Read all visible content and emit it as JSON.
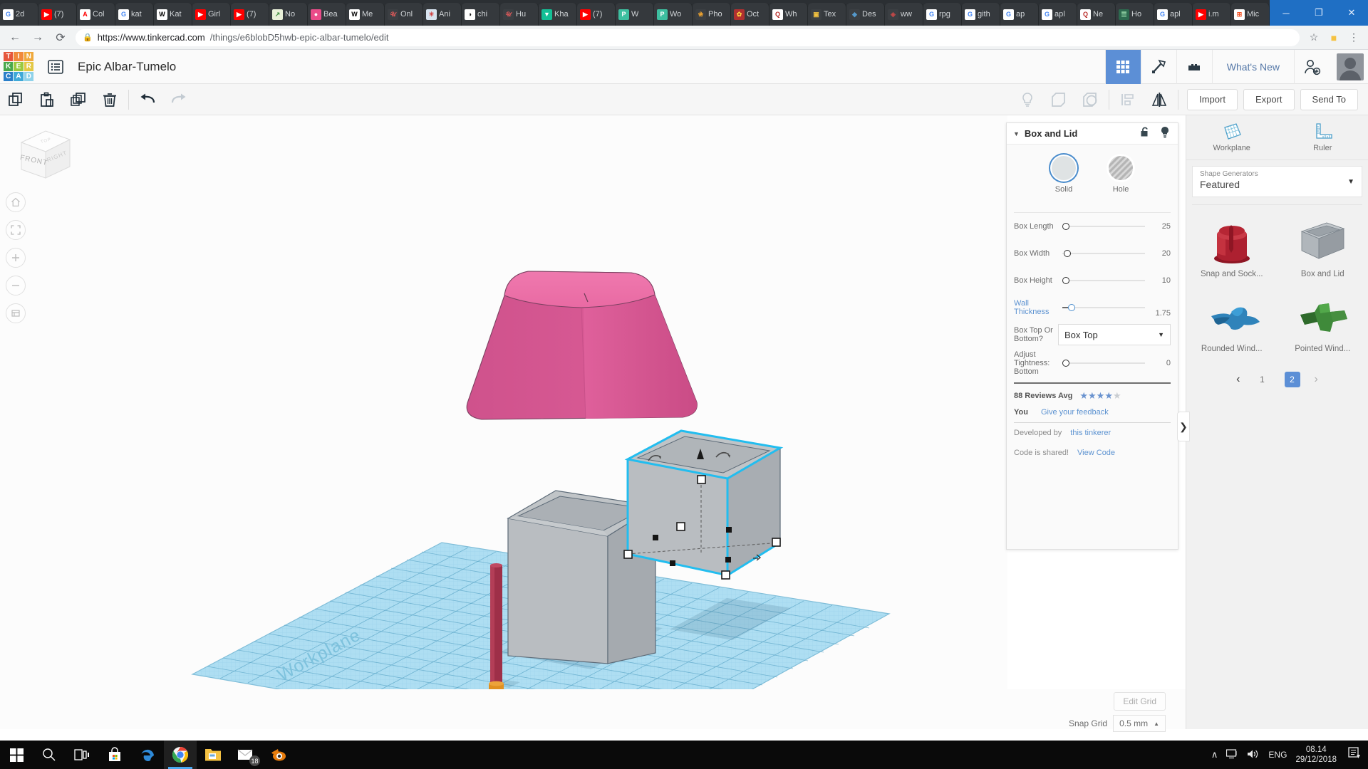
{
  "browser": {
    "tabs": [
      {
        "label": "2d",
        "favicon": "google-icon",
        "color": "#ffffff",
        "glyph": "G",
        "glyph_color": "#4285f4"
      },
      {
        "label": "(7)",
        "favicon": "youtube-icon",
        "color": "#ff0000",
        "glyph": "▶",
        "glyph_color": "#ffffff"
      },
      {
        "label": "Col",
        "favicon": "adobe-icon",
        "color": "#ffffff",
        "glyph": "A",
        "glyph_color": "#ff0000"
      },
      {
        "label": "kat",
        "favicon": "google-icon",
        "color": "#ffffff",
        "glyph": "G",
        "glyph_color": "#4285f4"
      },
      {
        "label": "Kat",
        "favicon": "wikipedia-icon",
        "color": "#ffffff",
        "glyph": "W",
        "glyph_color": "#000000"
      },
      {
        "label": "Girl",
        "favicon": "youtube-icon",
        "color": "#ff0000",
        "glyph": "▶",
        "glyph_color": "#ffffff"
      },
      {
        "label": "(7)",
        "favicon": "youtube-icon",
        "color": "#ff0000",
        "glyph": "▶",
        "glyph_color": "#ffffff"
      },
      {
        "label": "No",
        "favicon": "chart-icon",
        "color": "#e8f0d8",
        "glyph": "↗",
        "glyph_color": "#3c8c3c"
      },
      {
        "label": "Bea",
        "favicon": "dribbble-icon",
        "color": "#ea4c89",
        "glyph": "●",
        "glyph_color": "#ffffff"
      },
      {
        "label": "Me",
        "favicon": "wikipedia-icon",
        "color": "#ffffff",
        "glyph": "W",
        "glyph_color": "#000000"
      },
      {
        "label": "Onl",
        "favicon": "script-icon",
        "color": "#3b3f43",
        "glyph": "𝒰",
        "glyph_color": "#e05a5a"
      },
      {
        "label": "Ani",
        "favicon": "anime-icon",
        "color": "#d8e4f0",
        "glyph": "☀",
        "glyph_color": "#d04040"
      },
      {
        "label": "chi",
        "favicon": "pocket-icon",
        "color": "#ffffff",
        "glyph": "◑",
        "glyph_color": "#111111"
      },
      {
        "label": "Hu",
        "favicon": "script-icon",
        "color": "#3b3f43",
        "glyph": "𝒰",
        "glyph_color": "#e05a5a"
      },
      {
        "label": "Kha",
        "favicon": "khan-icon",
        "color": "#14bf96",
        "glyph": "▼",
        "glyph_color": "#ffffff"
      },
      {
        "label": "(7)",
        "favicon": "youtube-icon",
        "color": "#ff0000",
        "glyph": "▶",
        "glyph_color": "#ffffff"
      },
      {
        "label": "W",
        "favicon": "teal-icon",
        "color": "#3dbfa0",
        "glyph": "P",
        "glyph_color": "#ffffff"
      },
      {
        "label": "Wo",
        "favicon": "teal-icon",
        "color": "#3dbfa0",
        "glyph": "P",
        "glyph_color": "#ffffff"
      },
      {
        "label": "Pho",
        "favicon": "flower-icon",
        "color": "#3b3f43",
        "glyph": "❀",
        "glyph_color": "#e8a030"
      },
      {
        "label": "Oct",
        "favicon": "fire-icon",
        "color": "#b03030",
        "glyph": "✿",
        "glyph_color": "#ffd040"
      },
      {
        "label": "Wh",
        "favicon": "quora-icon",
        "color": "#ffffff",
        "glyph": "Q",
        "glyph_color": "#b92b27"
      },
      {
        "label": "Tex",
        "favicon": "blocks-icon",
        "color": "#3b3f43",
        "glyph": "▣",
        "glyph_color": "#f0c040"
      },
      {
        "label": "Des",
        "favicon": "blue-icon",
        "color": "#3b3f43",
        "glyph": "◆",
        "glyph_color": "#5599cc"
      },
      {
        "label": "ww",
        "favicon": "ruby-icon",
        "color": "#3b3f43",
        "glyph": "◈",
        "glyph_color": "#c04848"
      },
      {
        "label": "rpg",
        "favicon": "google-icon",
        "color": "#ffffff",
        "glyph": "G",
        "glyph_color": "#4285f4"
      },
      {
        "label": "gith",
        "favicon": "google-icon",
        "color": "#ffffff",
        "glyph": "G",
        "glyph_color": "#4285f4"
      },
      {
        "label": "ap",
        "favicon": "google-icon",
        "color": "#ffffff",
        "glyph": "G",
        "glyph_color": "#4285f4"
      },
      {
        "label": "apl",
        "favicon": "google-icon",
        "color": "#ffffff",
        "glyph": "G",
        "glyph_color": "#4285f4"
      },
      {
        "label": "Ne",
        "favicon": "quora-icon",
        "color": "#ffffff",
        "glyph": "Q",
        "glyph_color": "#b92b27"
      },
      {
        "label": "Ho",
        "favicon": "green-icon",
        "color": "#2d6a4f",
        "glyph": "☰",
        "glyph_color": "#9fe0b0"
      },
      {
        "label": "apl",
        "favicon": "google-icon",
        "color": "#ffffff",
        "glyph": "G",
        "glyph_color": "#4285f4"
      },
      {
        "label": "i.m",
        "favicon": "youtube-icon",
        "color": "#ff0000",
        "glyph": "▶",
        "glyph_color": "#ffffff"
      },
      {
        "label": "Mic",
        "favicon": "microsoft-icon",
        "color": "#ffffff",
        "glyph": "⊞",
        "glyph_color": "#f25022"
      }
    ],
    "active_tab": {
      "label": "",
      "favicon": "tinkercad-icon",
      "close": "×"
    },
    "newtab_label": "+",
    "window_controls": {
      "minimize": "─",
      "maximize": "❐",
      "close": "✕"
    },
    "nav": {
      "back": "←",
      "forward": "→",
      "reload": "⟳"
    },
    "url": {
      "lock": "🔒",
      "host": "https://www.tinkercad.com",
      "path": "/things/e6blobD5hwb-epic-albar-tumelo/edit"
    },
    "right_icons": [
      {
        "name": "star-icon",
        "glyph": "☆"
      },
      {
        "name": "extension-icon",
        "glyph": "■"
      },
      {
        "name": "menu-icon",
        "glyph": "⋮"
      }
    ]
  },
  "app_header": {
    "logo_tiles": [
      {
        "letter": "T",
        "color": "#e5563c"
      },
      {
        "letter": "I",
        "color": "#f08a3c"
      },
      {
        "letter": "N",
        "color": "#f0a93c"
      },
      {
        "letter": "K",
        "color": "#49a84c"
      },
      {
        "letter": "E",
        "color": "#9ac93f"
      },
      {
        "letter": "R",
        "color": "#e3c845"
      },
      {
        "letter": "C",
        "color": "#2a7fc9"
      },
      {
        "letter": "A",
        "color": "#3fa9d8"
      },
      {
        "letter": "D",
        "color": "#8fd2ea"
      }
    ],
    "hamburger_icon": "list-menu-icon",
    "doc_title": "Epic Albar-Tumelo",
    "buttons": [
      {
        "name": "grid-view-button",
        "glyph": "▦",
        "active": true
      },
      {
        "name": "pickaxe-button",
        "glyph": "⛏",
        "active": false
      },
      {
        "name": "blocks-button",
        "glyph": "▤",
        "active": false
      }
    ],
    "whats_new": "What's New",
    "invite_icon": "add-person-icon",
    "avatar": "user-avatar"
  },
  "toolbar": {
    "left_tools": [
      {
        "name": "copy-button",
        "glyph": "⧉"
      },
      {
        "name": "paste-button",
        "glyph": "📋"
      },
      {
        "name": "duplicate-button",
        "glyph": "❐"
      },
      {
        "name": "delete-button",
        "glyph": "🗑"
      },
      {
        "name": "undo-button",
        "glyph": "←"
      },
      {
        "name": "redo-button",
        "glyph": "→"
      }
    ],
    "right_tools": [
      {
        "name": "light-bulb-button",
        "glyph": "○"
      },
      {
        "name": "group-button",
        "glyph": "⬡"
      },
      {
        "name": "ungroup-button",
        "glyph": "◎"
      },
      {
        "name": "align-button",
        "glyph": "▥"
      },
      {
        "name": "mirror-button",
        "glyph": "◧"
      }
    ],
    "import_label": "Import",
    "export_label": "Export",
    "sendto_label": "Send To"
  },
  "viewport": {
    "viewcube": {
      "front": "FRONT",
      "right": "RIGHT",
      "top": "TOP"
    },
    "nav_buttons": [
      {
        "name": "home-view-button",
        "glyph": "⌂"
      },
      {
        "name": "fit-view-button",
        "glyph": "⬚"
      },
      {
        "name": "zoom-in-button",
        "glyph": "+"
      },
      {
        "name": "zoom-out-button",
        "glyph": "−"
      },
      {
        "name": "flat-view-button",
        "glyph": "⌸"
      }
    ],
    "workplane_label": "Workplane",
    "objects": [
      {
        "name": "pink-lid",
        "color": "#e0579a",
        "type": "tapered-box"
      },
      {
        "name": "grey-box-unselected",
        "color": "#b9bcbf",
        "type": "open-box"
      },
      {
        "name": "grey-box-selected",
        "color": "#b4b7ba",
        "type": "open-box",
        "selected": true,
        "highlight": "#22bdef"
      },
      {
        "name": "red-cylinder",
        "color": "#a03048",
        "type": "cylinder"
      },
      {
        "name": "orange-base",
        "color": "#e09020",
        "type": "cylinder"
      }
    ],
    "workplane_color": "#a8dcf0"
  },
  "properties_panel": {
    "title": "Box and Lid",
    "caret": "▼",
    "lock_icon": "unlock-icon",
    "bulb_icon": "light-bulb-icon",
    "solid_label": "Solid",
    "hole_label": "Hole",
    "sliders": [
      {
        "label": "Box Length",
        "value": "25",
        "knob_pct": 0,
        "fill_pct": 0,
        "link": false
      },
      {
        "label": "Box Width",
        "value": "20",
        "knob_pct": 0,
        "fill_pct": 0,
        "link": false
      },
      {
        "label": "Box Height",
        "value": "10",
        "knob_pct": 0,
        "fill_pct": 0,
        "link": false
      },
      {
        "label": "Wall Thickness",
        "value": "1.75",
        "knob_pct": 7,
        "fill_pct": 7,
        "link": true
      }
    ],
    "select_label": "Box Top Or Bottom?",
    "select_value": "Box Top",
    "select_caret": "▼",
    "tightness_label": "Adjust Tightness: Bottom",
    "tightness_value": "0",
    "reviews_text": "88 Reviews Avg",
    "stars_filled": 4,
    "stars_total": 5,
    "you_label": "You",
    "feedback_link": "Give your feedback",
    "developed_by_label": "Developed by",
    "developer_link": "this tinkerer",
    "code_shared_label": "Code is shared!",
    "view_code_link": "View Code"
  },
  "right_sidebar": {
    "tools": [
      {
        "label": "Workplane",
        "icon": "workplane-grid-icon"
      },
      {
        "label": "Ruler",
        "icon": "ruler-icon"
      }
    ],
    "generator_caption": "Shape Generators",
    "generator_value": "Featured",
    "generator_caret": "▼",
    "shapes": [
      {
        "name": "Snap and Sock...",
        "color": "#b01f2e"
      },
      {
        "name": "Box and Lid",
        "color": "#9aa0a6"
      },
      {
        "name": "Rounded Wind...",
        "color": "#2a7fb5"
      },
      {
        "name": "Pointed Wind...",
        "color": "#3f8a3a"
      }
    ],
    "pager": {
      "prev": "‹",
      "next": "›",
      "pages": [
        "1",
        "2"
      ],
      "current": "2"
    },
    "collapse_handle": "❯"
  },
  "bottom_bar": {
    "edit_grid_label": "Edit Grid",
    "snap_grid_label": "Snap Grid",
    "snap_grid_value": "0.5 mm",
    "snap_caret": "▲"
  },
  "taskbar": {
    "items": [
      {
        "name": "start-button",
        "glyph": "⊞",
        "color": "#ffffff"
      },
      {
        "name": "search-button",
        "glyph": "⌕",
        "color": "#ffffff"
      },
      {
        "name": "task-view-button",
        "glyph": "☰",
        "color": "#ffffff"
      },
      {
        "name": "store-button",
        "glyph": "🛍",
        "color": "#ffffff"
      },
      {
        "name": "edge-button",
        "glyph": "e",
        "color": "#4aa8ef"
      },
      {
        "name": "chrome-button",
        "glyph": "◉",
        "color": "#4285f4",
        "active": true
      },
      {
        "name": "explorer-button",
        "glyph": "📁",
        "color": "#f5c242"
      },
      {
        "name": "mail-button",
        "glyph": "✉",
        "color": "#ffffff",
        "badge": "18"
      },
      {
        "name": "blender-button",
        "glyph": "◔",
        "color": "#e87d0d"
      }
    ],
    "tray": [
      {
        "name": "show-hidden-icons",
        "glyph": "∧"
      },
      {
        "name": "network-icon",
        "glyph": "□"
      },
      {
        "name": "volume-icon",
        "glyph": "🔊"
      }
    ],
    "language": "ENG",
    "time": "08.14",
    "date": "29/12/2018",
    "notification_icon": "notification-icon"
  }
}
